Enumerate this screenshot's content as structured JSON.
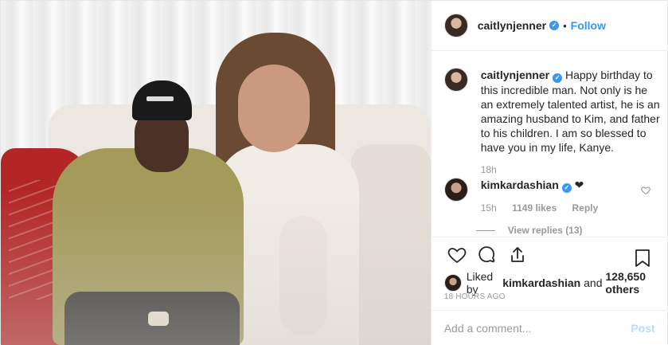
{
  "header": {
    "username": "caitlynjenner",
    "verified_mark": "✓",
    "separator": "•",
    "follow_label": "Follow"
  },
  "caption": {
    "username": "caitlynjenner",
    "text": "Happy birthday to this incredible man. Not only is he an extremely talented artist, he is an amazing husband to Kim, and father to his children. I am so blessed to have you in my life, Kanye.",
    "age": "18h"
  },
  "top_comment": {
    "username": "kimkardashian",
    "text": "❤",
    "age": "15h",
    "likes": "1149 likes",
    "reply_label": "Reply",
    "view_replies": "View replies (13)"
  },
  "actions": {
    "like_icon": "heart-icon",
    "comment_icon": "comment-icon",
    "share_icon": "share-icon",
    "save_icon": "bookmark-icon"
  },
  "likes": {
    "prefix": "Liked by",
    "user": "kimkardashian",
    "middle": "and",
    "count": "128,650 others"
  },
  "timestamp": "18 HOURS AGO",
  "add_comment": {
    "placeholder": "Add a comment...",
    "post_label": "Post"
  },
  "colors": {
    "accent": "#3897f0",
    "post_disabled": "#b2dffc"
  }
}
